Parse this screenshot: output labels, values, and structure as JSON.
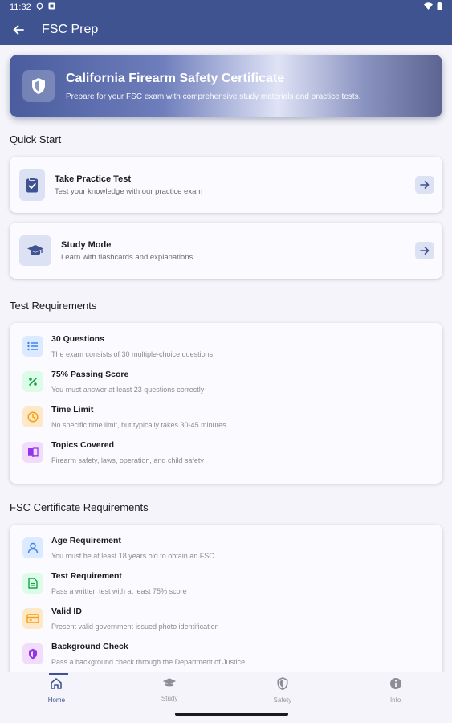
{
  "status_bar": {
    "time": "11:32"
  },
  "app_bar": {
    "title": "FSC Prep"
  },
  "hero": {
    "title": "California Firearm Safety Certificate",
    "subtitle": "Prepare for your FSC exam with comprehensive study materials and practice tests."
  },
  "quick_start": {
    "heading": "Quick Start",
    "items": [
      {
        "title": "Take Practice Test",
        "subtitle": "Test your knowledge with our practice exam",
        "icon": "clipboard-check-icon"
      },
      {
        "title": "Study Mode",
        "subtitle": "Learn with flashcards and explanations",
        "icon": "graduation-cap-icon"
      }
    ]
  },
  "test_requirements": {
    "heading": "Test Requirements",
    "items": [
      {
        "title": "30 Questions",
        "subtitle": "The exam consists of 30 multiple-choice questions",
        "icon": "list-icon",
        "color": "#3b82f6",
        "bg": "#dbeafe"
      },
      {
        "title": "75% Passing Score",
        "subtitle": "You must answer at least 23 questions correctly",
        "icon": "percent-icon",
        "color": "#16a34a",
        "bg": "#dcfce7"
      },
      {
        "title": "Time Limit",
        "subtitle": "No specific time limit, but typically takes 30-45 minutes",
        "icon": "clock-icon",
        "color": "#f59e0b",
        "bg": "#fde9c8"
      },
      {
        "title": "Topics Covered",
        "subtitle": "Firearm safety, laws, operation, and child safety",
        "icon": "book-icon",
        "color": "#9333ea",
        "bg": "#f1dcfb"
      }
    ]
  },
  "fsc_requirements": {
    "heading": "FSC Certificate Requirements",
    "items": [
      {
        "title": "Age Requirement",
        "subtitle": "You must be at least 18 years old to obtain an FSC",
        "icon": "person-icon",
        "color": "#3b82f6",
        "bg": "#dbeafe"
      },
      {
        "title": "Test Requirement",
        "subtitle": "Pass a written test with at least 75% score",
        "icon": "document-icon",
        "color": "#16a34a",
        "bg": "#dcfce7"
      },
      {
        "title": "Valid ID",
        "subtitle": "Present valid government-issued photo identification",
        "icon": "id-card-icon",
        "color": "#f59e0b",
        "bg": "#fde9c8"
      },
      {
        "title": "Background Check",
        "subtitle": "Pass a background check through the Department of Justice",
        "icon": "shield-icon",
        "color": "#9333ea",
        "bg": "#f1dcfb"
      }
    ]
  },
  "bottom_nav": {
    "items": [
      {
        "label": "Home",
        "icon": "home-icon",
        "active": true
      },
      {
        "label": "Study",
        "icon": "graduation-cap-icon",
        "active": false
      },
      {
        "label": "Safety",
        "icon": "shield-icon",
        "active": false
      },
      {
        "label": "Info",
        "icon": "info-icon",
        "active": false
      }
    ]
  },
  "colors": {
    "primary": "#3f5391",
    "background": "#f4f4fa",
    "card": "#fbfbff"
  }
}
